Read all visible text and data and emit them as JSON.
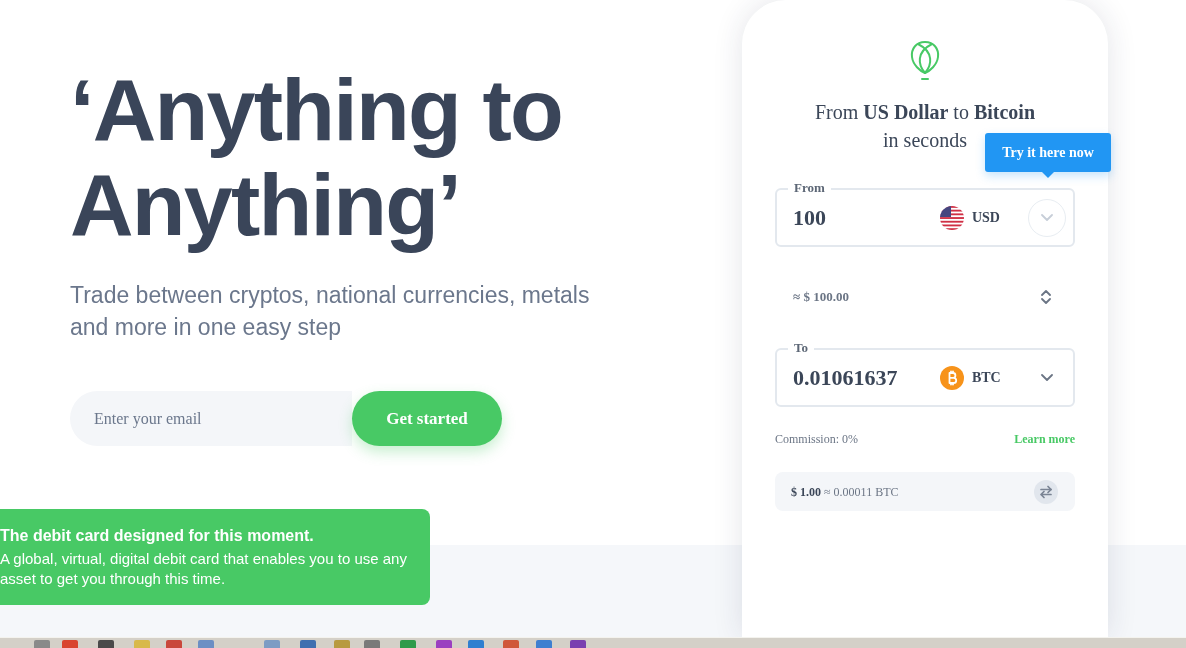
{
  "hero": {
    "headline": "‘Anything to Anything’",
    "subtitle": "Trade between cryptos, national currencies, metals and more in one easy step",
    "email_field": {
      "placeholder": "Enter your email"
    },
    "cta_button": "Get started"
  },
  "promo_card": {
    "title": "The debit card designed for this moment.",
    "body": "A global, virtual, digital debit card that enables you to use any asset to get you through this time."
  },
  "converter": {
    "heading_lines": [
      "From **US Dollar** to **Bitcoin**",
      "in seconds"
    ],
    "tooltip": "Try it here now",
    "from_field": {
      "label": "From",
      "value": "100",
      "currency": {
        "code": "USD",
        "kind": "usd"
      },
      "dropdown_highlighted": true
    },
    "estimate": "≈ $ 100.00",
    "to_field": {
      "label": "To",
      "value": "0.01061637",
      "currency": {
        "code": "BTC",
        "kind": "btc"
      },
      "dropdown_highlighted": false
    },
    "commission": "Commission: 0%",
    "learn_more": "Learn more",
    "rate": "**$ 1.00** ≈ 0.00011 BTC"
  }
}
